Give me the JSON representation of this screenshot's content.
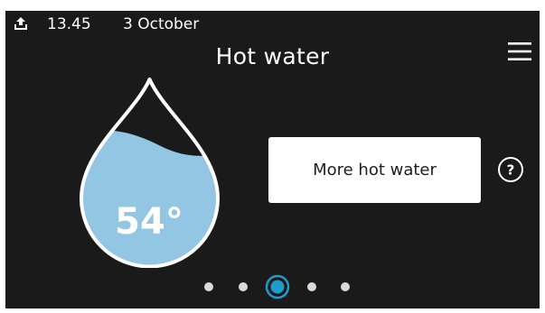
{
  "status_bar": {
    "time": "13.45",
    "date": "3 October",
    "icon": "upload-icon"
  },
  "title": "Hot water",
  "menu": {
    "icon": "hamburger-menu-icon"
  },
  "hot_water": {
    "temperature": "54°",
    "fill_fraction": 0.55,
    "fill_color": "#92c6e2"
  },
  "button": {
    "label": "More hot water"
  },
  "help": {
    "icon": "question-icon",
    "glyph": "?"
  },
  "pagination": {
    "pages": 5,
    "active_page": 3
  },
  "colors": {
    "background": "#1a1a1a",
    "foreground": "#ffffff",
    "accent": "#1f9ccb"
  }
}
